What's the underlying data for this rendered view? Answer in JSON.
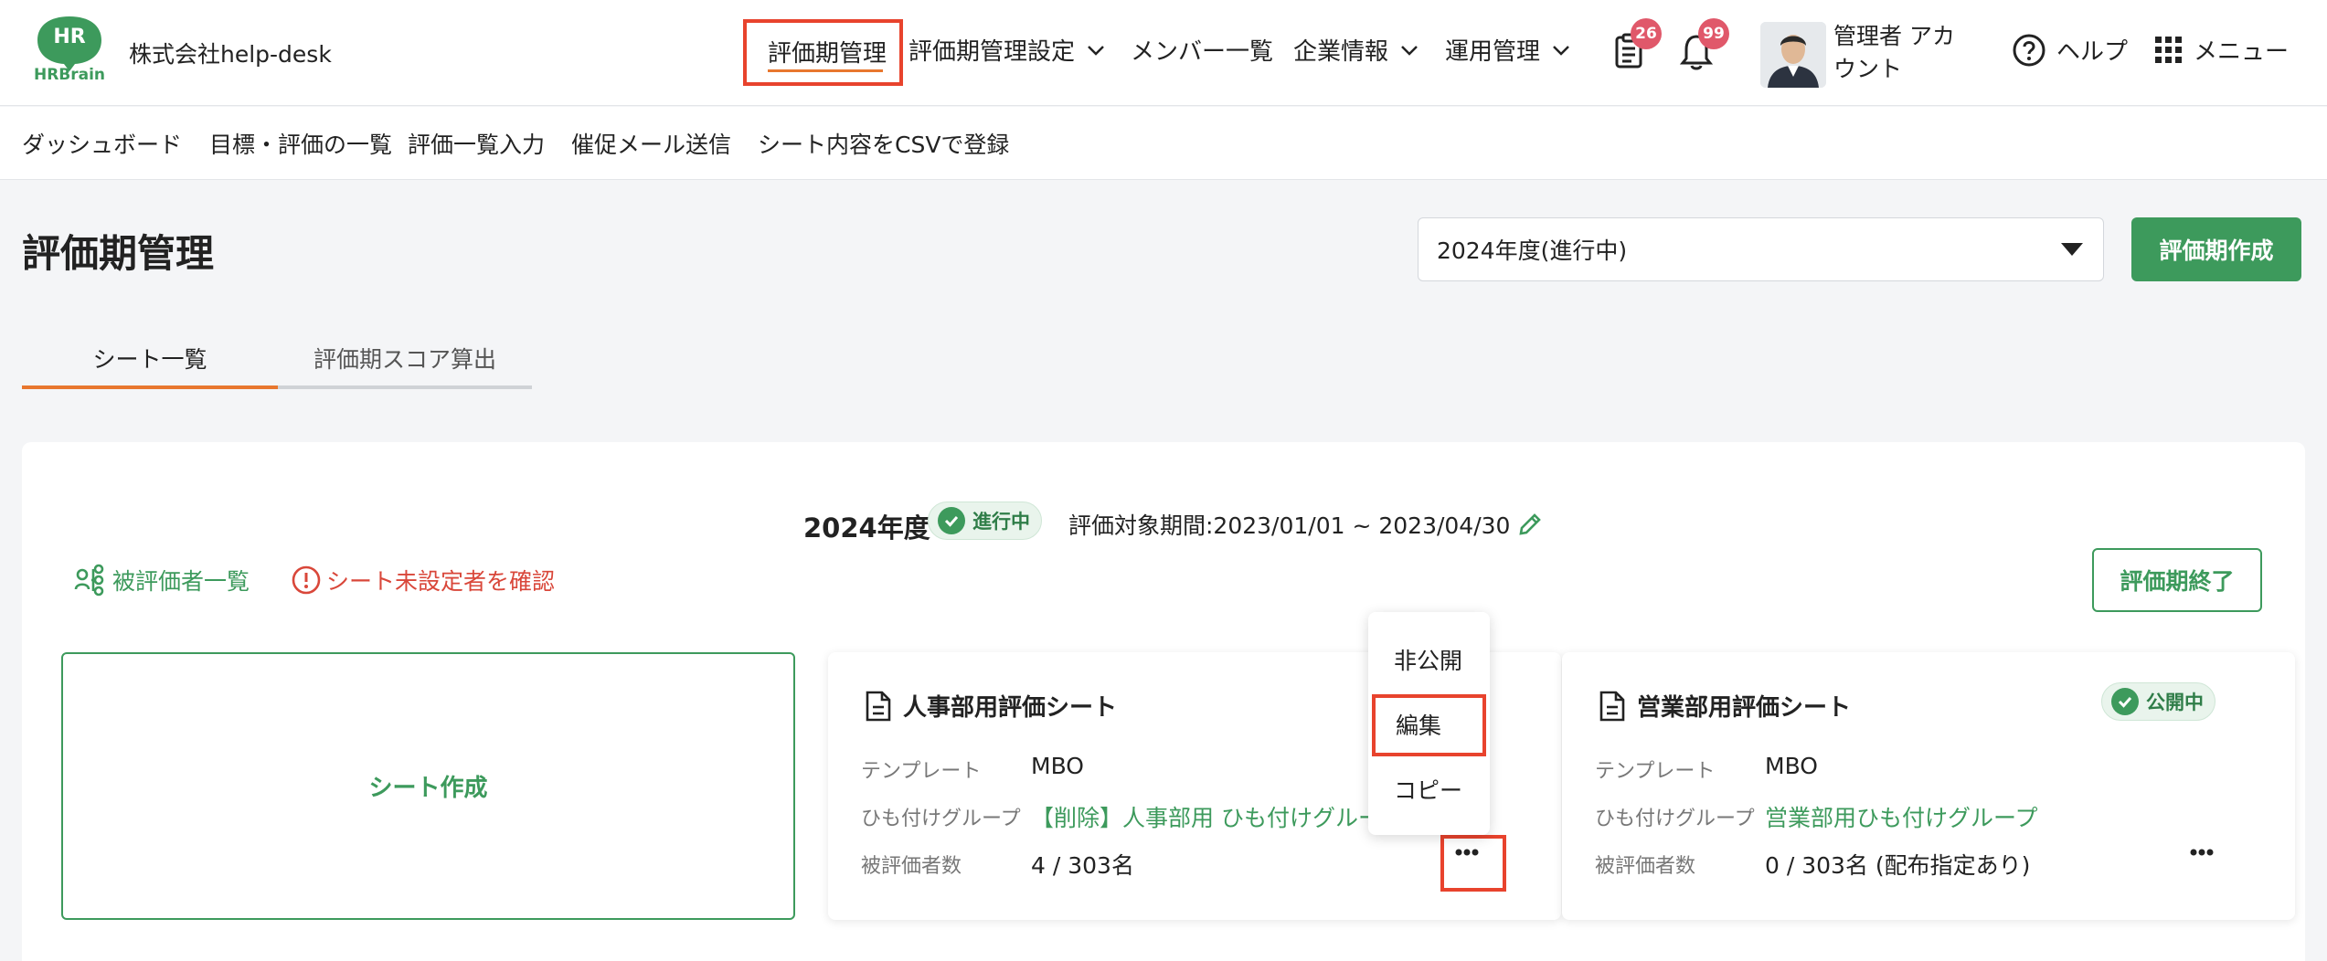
{
  "header": {
    "logo_text": "HR",
    "logo_brand": "HRBrain",
    "company": "株式会社help-desk",
    "nav": [
      {
        "label": "評価期管理"
      },
      {
        "label": "評価期管理設定"
      },
      {
        "label": "メンバー一覧"
      },
      {
        "label": "企業情報"
      },
      {
        "label": "運用管理"
      }
    ],
    "doc_badge": "26",
    "bell_badge": "99",
    "user_name": "管理者 アカウント",
    "help_label": "ヘルプ",
    "menu_label": "メニュー"
  },
  "subnav": [
    "ダッシュボード",
    "目標・評価の一覧",
    "評価一覧入力",
    "催促メール送信",
    "シート内容をCSVで登録"
  ],
  "page": {
    "title": "評価期管理",
    "period_select": "2024年度(進行中)",
    "create_button": "評価期作成"
  },
  "tabs": [
    {
      "label": "シート一覧",
      "active": true
    },
    {
      "label": "評価期スコア算出",
      "active": false
    }
  ],
  "period": {
    "year": "2024年度",
    "status": "進行中",
    "range": "評価対象期間:2023/01/01 ~ 2023/04/30",
    "evaluatee_list_link": "被評価者一覧",
    "unassigned_link": "シート未設定者を確認",
    "end_button": "評価期終了"
  },
  "sheet_create_label": "シート作成",
  "cards": [
    {
      "title": "人事部用評価シート",
      "template_label": "テンプレート",
      "template_value": "MBO",
      "group_label": "ひも付けグループ",
      "group_value": "【削除】人事部用 ひも付けグループ",
      "count_label": "被評価者数",
      "count_value": "4 / 303名"
    },
    {
      "title": "営業部用評価シート",
      "status": "公開中",
      "template_label": "テンプレート",
      "template_value": "MBO",
      "group_label": "ひも付けグループ",
      "group_value": "営業部用ひも付けグループ",
      "count_label": "被評価者数",
      "count_value": "0 / 303名 (配布指定あり)"
    }
  ],
  "dropdown": [
    "非公開",
    "編集",
    "コピー"
  ],
  "colors": {
    "accent_green": "#3d9a5c",
    "highlight_red": "#e8432d",
    "tab_orange": "#e8772e",
    "badge_pink": "#e0586a"
  }
}
